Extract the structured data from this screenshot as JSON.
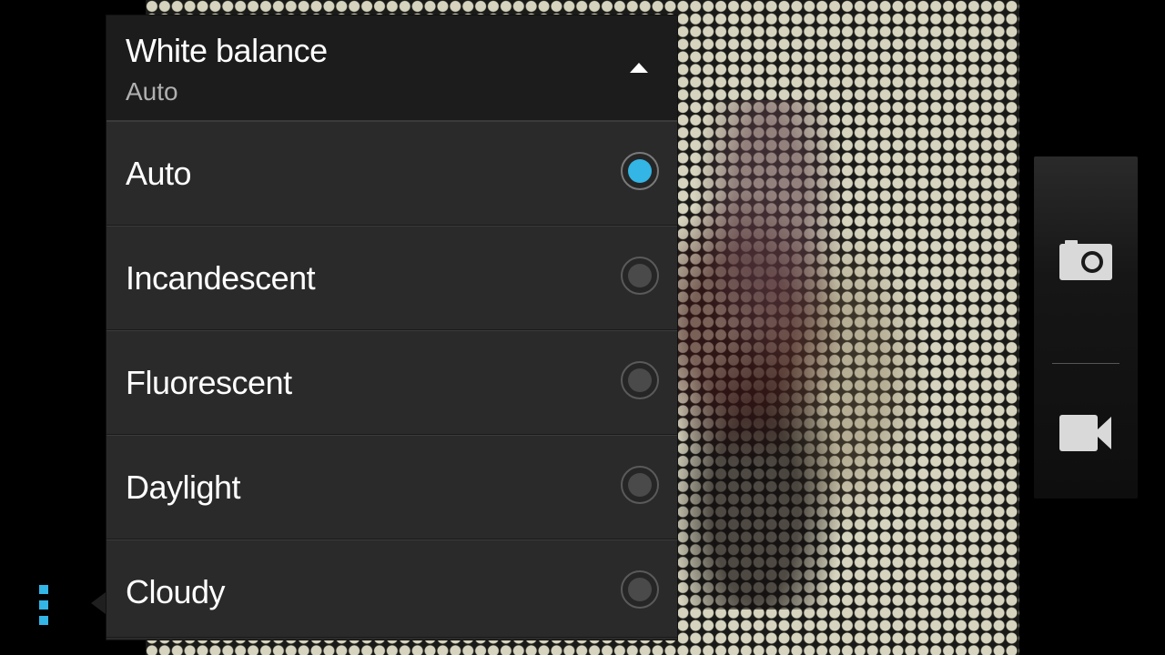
{
  "popup": {
    "title": "White balance",
    "current_value": "Auto",
    "options": [
      {
        "label": "Auto",
        "selected": true
      },
      {
        "label": "Incandescent",
        "selected": false
      },
      {
        "label": "Fluorescent",
        "selected": false
      },
      {
        "label": "Daylight",
        "selected": false
      },
      {
        "label": "Cloudy",
        "selected": false
      }
    ]
  },
  "icons": {
    "collapse": "chevron-up-icon",
    "menu": "overflow-menu-icon",
    "camera": "camera-icon",
    "video": "video-camera-icon"
  },
  "colors": {
    "accent": "#33b5e5",
    "popup_bg": "#2b2b2b",
    "header_bg": "#1c1c1c"
  }
}
